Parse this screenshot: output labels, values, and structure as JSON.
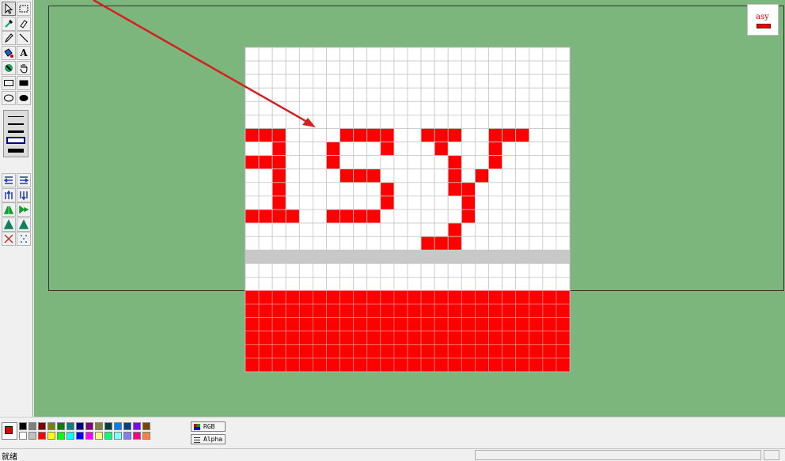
{
  "toolbar": {
    "tools": [
      {
        "name": "select-arrow",
        "icon": "cursor-arrow-icon"
      },
      {
        "name": "rect-select",
        "icon": "dashed-rect-icon"
      },
      {
        "name": "eyedropper",
        "icon": "eyedropper-icon"
      },
      {
        "name": "eraser",
        "icon": "eraser-icon"
      },
      {
        "name": "pencil",
        "icon": "pencil-icon"
      },
      {
        "name": "line",
        "icon": "line-icon"
      },
      {
        "name": "fill",
        "icon": "paint-bucket-icon"
      },
      {
        "name": "text",
        "icon": "text-icon",
        "label": "A"
      },
      {
        "name": "color-replace",
        "icon": "color-replace-icon"
      },
      {
        "name": "hand",
        "icon": "hand-icon"
      },
      {
        "name": "rect-outline",
        "icon": "rect-outline-icon"
      },
      {
        "name": "rect-filled",
        "icon": "rect-filled-icon"
      },
      {
        "name": "ellipse-outline",
        "icon": "ellipse-outline-icon"
      },
      {
        "name": "ellipse-filled",
        "icon": "ellipse-filled-icon"
      }
    ],
    "transform_tools": [
      "shift-left-icon",
      "shift-right-icon",
      "shift-up-icon",
      "shift-down-icon",
      "flip-horizontal-icon",
      "rotate-right-icon",
      "flip-vertical-icon",
      "rotate-left-icon",
      "sparkle-icon",
      "scatter-dots-icon"
    ]
  },
  "canvas": {
    "background": "#7cb67c",
    "grid_cols": 24,
    "grid_rows": 24,
    "pixel_color": "#ff0000",
    "stripe_color": "#c8c8c8",
    "stripe_row": 15,
    "red_band_start_row": 18,
    "glyphs": [
      {
        "char": "a",
        "cells": [
          [
            0,
            6
          ],
          [
            1,
            6
          ],
          [
            2,
            6
          ],
          [
            2,
            7
          ],
          [
            0,
            8
          ],
          [
            1,
            8
          ],
          [
            2,
            8
          ],
          [
            2,
            9
          ],
          [
            2,
            10
          ],
          [
            2,
            11
          ],
          [
            0,
            12
          ],
          [
            1,
            12
          ],
          [
            2,
            12
          ],
          [
            3,
            12
          ]
        ]
      },
      {
        "char": "s",
        "cells": [
          [
            7,
            6
          ],
          [
            8,
            6
          ],
          [
            9,
            6
          ],
          [
            10,
            6
          ],
          [
            6,
            7
          ],
          [
            10,
            7
          ],
          [
            6,
            8
          ],
          [
            7,
            9
          ],
          [
            8,
            9
          ],
          [
            9,
            9
          ],
          [
            10,
            10
          ],
          [
            10,
            11
          ],
          [
            6,
            12
          ],
          [
            7,
            12
          ],
          [
            8,
            12
          ],
          [
            9,
            12
          ]
        ]
      },
      {
        "char": "y",
        "cells": [
          [
            13,
            6
          ],
          [
            14,
            6
          ],
          [
            15,
            6
          ],
          [
            18,
            6
          ],
          [
            19,
            6
          ],
          [
            20,
            6
          ],
          [
            14,
            7
          ],
          [
            18,
            7
          ],
          [
            15,
            8
          ],
          [
            18,
            8
          ],
          [
            15,
            9
          ],
          [
            17,
            9
          ],
          [
            15,
            10
          ],
          [
            16,
            10
          ],
          [
            16,
            11
          ],
          [
            16,
            12
          ],
          [
            15,
            13
          ],
          [
            13,
            14
          ],
          [
            14,
            14
          ],
          [
            15,
            14
          ]
        ]
      }
    ]
  },
  "thumbnail": {
    "text": "asy"
  },
  "palette": {
    "current_color": "#e00000",
    "row1": [
      "#000000",
      "#808080",
      "#800000",
      "#808000",
      "#008000",
      "#008080",
      "#000080",
      "#800080",
      "#808040",
      "#004040",
      "#0080ff",
      "#004080",
      "#8000ff",
      "#804000"
    ],
    "row2": [
      "#ffffff",
      "#c0c0c0",
      "#ff0000",
      "#ffff00",
      "#00ff00",
      "#00ffff",
      "#0000ff",
      "#ff00ff",
      "#ffff80",
      "#00ff80",
      "#80ffff",
      "#8080ff",
      "#ff0080",
      "#ff8040"
    ]
  },
  "channels": {
    "rgb_label": "RGB",
    "alpha_label": "Alpha"
  },
  "status": {
    "text": "就绪"
  }
}
